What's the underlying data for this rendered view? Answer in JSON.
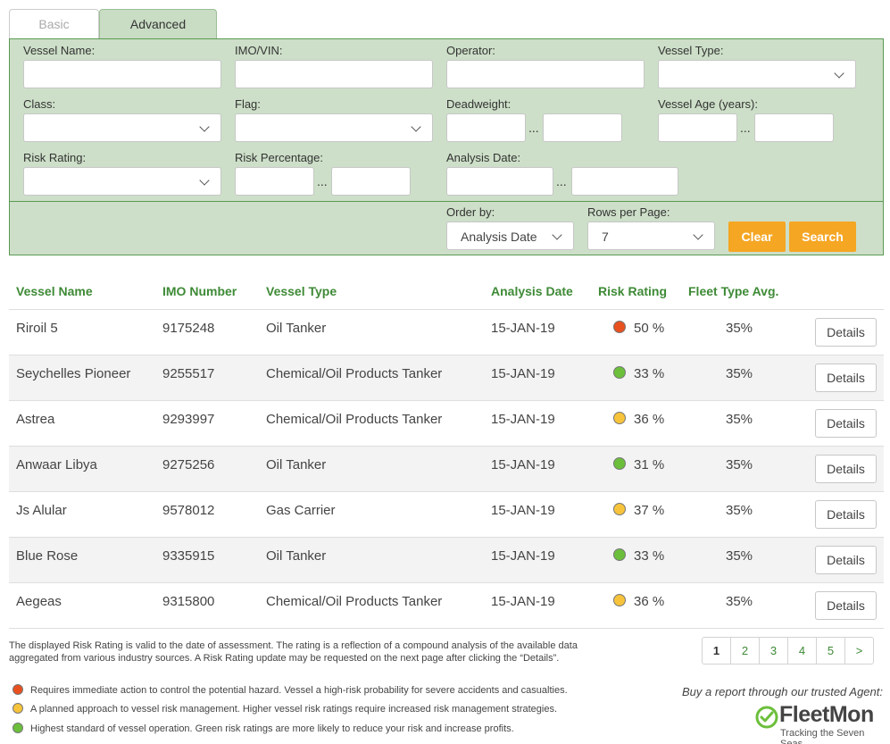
{
  "tabs": {
    "basic": "Basic search",
    "advanced": "Advanced search"
  },
  "filters": {
    "vessel_name": {
      "label": "Vessel Name:",
      "value": ""
    },
    "imo": {
      "label": "IMO/VIN:",
      "value": ""
    },
    "operator": {
      "label": "Operator:",
      "value": ""
    },
    "vessel_type": {
      "label": "Vessel Type:",
      "value": ""
    },
    "class": {
      "label": "Class:",
      "value": ""
    },
    "flag": {
      "label": "Flag:",
      "value": ""
    },
    "deadweight": {
      "label": "Deadweight:",
      "from": "",
      "to": ""
    },
    "vessel_age": {
      "label": "Vessel Age (years):",
      "from": "",
      "to": ""
    },
    "risk_rating": {
      "label": "Risk Rating:",
      "value": ""
    },
    "risk_percentage": {
      "label": "Risk Percentage:",
      "from": "",
      "to": ""
    },
    "analysis_date": {
      "label": "Analysis Date:",
      "from": "",
      "to": ""
    },
    "range_sep": "..."
  },
  "controls": {
    "order_by": {
      "label": "Order by:",
      "value": "Analysis Date"
    },
    "rows_per_page": {
      "label": "Rows per Page:",
      "value": "7"
    },
    "clear": "Clear",
    "search": "Search"
  },
  "table": {
    "headers": [
      "Vessel Name",
      "IMO Number",
      "Vessel Type",
      "Analysis Date",
      "Risk Rating",
      "Fleet Type Avg."
    ],
    "details_label": "Details",
    "rows": [
      {
        "name": "Riroil 5",
        "imo": "9175248",
        "type": "Oil Tanker",
        "date": "15-JAN-19",
        "risk": "50 %",
        "risk_level": "red",
        "avg": "35%"
      },
      {
        "name": "Seychelles Pioneer",
        "imo": "9255517",
        "type": "Chemical/Oil Products Tanker",
        "date": "15-JAN-19",
        "risk": "33 %",
        "risk_level": "green",
        "avg": "35%"
      },
      {
        "name": "Astrea",
        "imo": "9293997",
        "type": "Chemical/Oil Products Tanker",
        "date": "15-JAN-19",
        "risk": "36 %",
        "risk_level": "yellow",
        "avg": "35%"
      },
      {
        "name": "Anwaar Libya",
        "imo": "9275256",
        "type": "Oil Tanker",
        "date": "15-JAN-19",
        "risk": "31 %",
        "risk_level": "green",
        "avg": "35%"
      },
      {
        "name": "Js Alular",
        "imo": "9578012",
        "type": "Gas Carrier",
        "date": "15-JAN-19",
        "risk": "37 %",
        "risk_level": "yellow",
        "avg": "35%"
      },
      {
        "name": "Blue Rose",
        "imo": "9335915",
        "type": "Oil Tanker",
        "date": "15-JAN-19",
        "risk": "33 %",
        "risk_level": "green",
        "avg": "35%"
      },
      {
        "name": "Aegeas",
        "imo": "9315800",
        "type": "Chemical/Oil Products Tanker",
        "date": "15-JAN-19",
        "risk": "36 %",
        "risk_level": "yellow",
        "avg": "35%"
      }
    ]
  },
  "note": "The displayed Risk Rating is valid to the date of assessment. The rating is a reflection of a compound analysis of the available data aggregated from various industry sources. A Risk Rating update may be requested on the next page after clicking the “Details”.",
  "pagination": [
    "1",
    "2",
    "3",
    "4",
    "5",
    ">"
  ],
  "legend": [
    {
      "color": "red",
      "text": "Requires immediate action to control the potential hazard. Vessel a high-risk probability for severe accidents and casualties."
    },
    {
      "color": "yellow",
      "text": "A planned approach to vessel risk management. Higher vessel risk ratings require increased risk management strategies."
    },
    {
      "color": "green",
      "text": "Highest standard of vessel operation. Green risk ratings are more likely to reduce your risk and increase profits."
    }
  ],
  "agent": {
    "text": "Buy a report through our trusted Agent:",
    "brand": "FleetMon",
    "tagline": "Tracking the Seven Seas"
  },
  "colors": {
    "red": "#e8501e",
    "yellow": "#f6c33b",
    "green": "#6cbf3b",
    "accent": "#f5a623",
    "header_green": "#3e8a36"
  }
}
